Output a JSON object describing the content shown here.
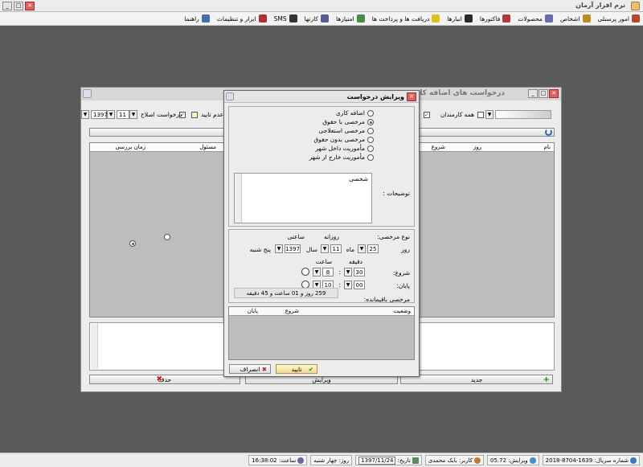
{
  "app": {
    "title": "نرم افزار آرمان"
  },
  "menu": [
    {
      "label": "امور پرسنلی",
      "icon": "personnel-icon",
      "color": "#b04a2a"
    },
    {
      "label": "اشخاص",
      "icon": "people-icon",
      "color": "#c08a2a"
    },
    {
      "label": "محصولات",
      "icon": "products-icon",
      "color": "#6a6ab0"
    },
    {
      "label": "فاکتورها",
      "icon": "invoices-icon",
      "color": "#b03a3a"
    },
    {
      "label": "انبارها",
      "icon": "warehouse-icon",
      "color": "#2a2a2a"
    },
    {
      "label": "دریافت ها و پرداخت ها",
      "icon": "payments-icon",
      "color": "#e0c020"
    },
    {
      "label": "امتیازها",
      "icon": "points-icon",
      "color": "#4a8a4a"
    },
    {
      "label": "کارتها",
      "icon": "cards-icon",
      "color": "#5a5a9a"
    },
    {
      "label": "SMS",
      "icon": "sms-icon",
      "color": "#333333"
    },
    {
      "label": "ابزار و تنظیمات",
      "icon": "tools-icon",
      "color": "#b03030"
    },
    {
      "label": "راهنما",
      "icon": "help-icon",
      "color": "#4a6ab0"
    }
  ],
  "status": {
    "serial": "شماره سریال: 1639-8704-2018",
    "version": "ویرایش: 05.72",
    "user": "کاربر: بابک محمدی",
    "date_label": "تاریخ:",
    "date": "1397/11/24",
    "day": "روز: چهار شنبه",
    "time": "ساعت: 16:38:02"
  },
  "back": {
    "title": "درخواست های اضافه کاری، مرخصی",
    "all_staff": "همه کارمندان",
    "not_approved": "عدم تایید",
    "correction": "درخواست اصلاح",
    "month": "11",
    "year": "1397",
    "cols": [
      "نام",
      "روز",
      "شروع",
      "مسئول",
      "زمان بررسی"
    ],
    "new_btn": "جدید",
    "edit_btn": "ویرایش",
    "delete_btn": "حذف"
  },
  "dlg": {
    "title": "ویرایش درخواست",
    "types": [
      "اضافه کاری",
      "مرخصی با حقوق",
      "مرخصی استعلاجی",
      "مرخصی بدون حقوق",
      "مأموریت داخل شهر",
      "مأموریت خارج از شهر"
    ],
    "desc_label": "توضیحات :",
    "desc_value": "شخصی",
    "leave_type_label": "نوع مرخصی:",
    "daily": "روزانه",
    "hourly": "ساعتی",
    "day_label": "روز",
    "day": "25",
    "month_label": "ماه",
    "month": "11",
    "year_label": "سال",
    "year": "1397",
    "weekday": "پنج شنبه",
    "minute_label": "دقیقه",
    "hour_label": "ساعت",
    "start_label": "شروع:",
    "start_min": "30",
    "start_hour": "8",
    "end_label": "پایان:",
    "end_min": "00",
    "end_hour": "10",
    "remain_label": "مرخصی باقیمانده:",
    "remain_value": "259 روز و 01 ساعت و 45 دقیقه",
    "cols": [
      "وضعیت",
      "شروع",
      "پایان"
    ],
    "ok": "تایید",
    "cancel": "انصراف"
  }
}
